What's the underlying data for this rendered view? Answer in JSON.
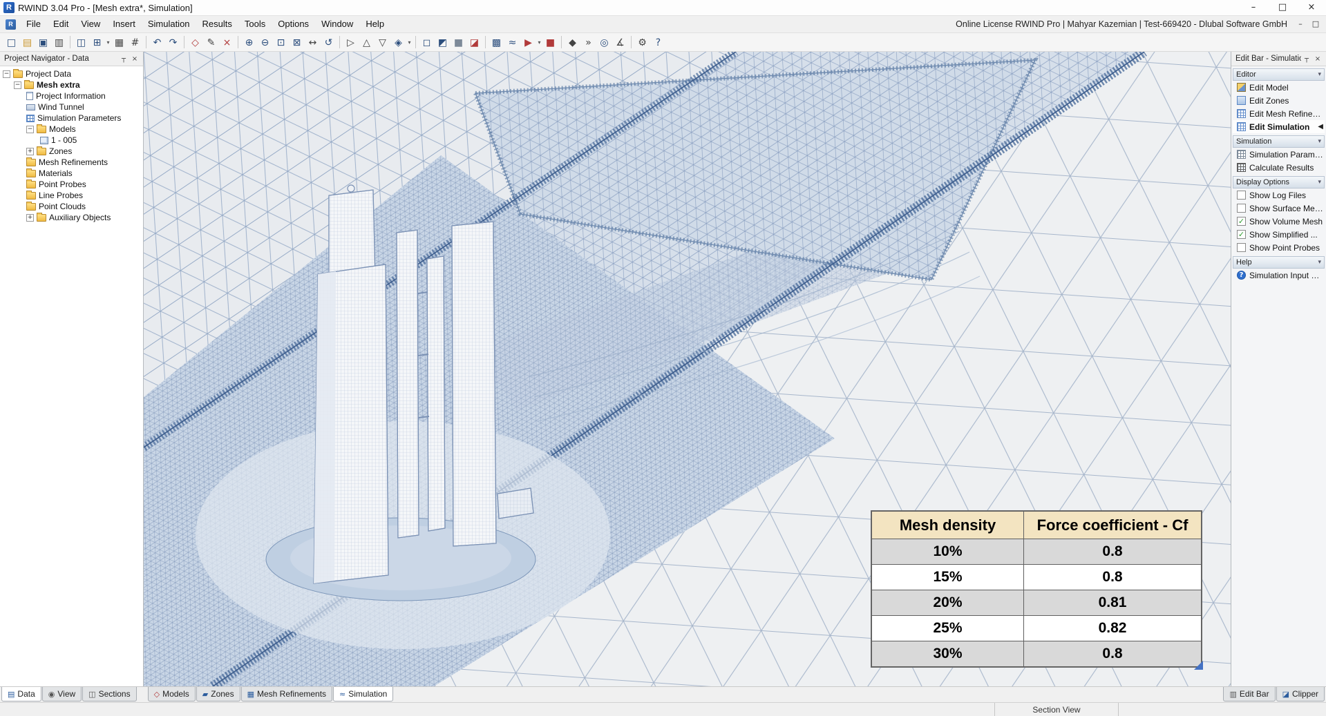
{
  "window": {
    "title": "RWIND 3.04 Pro - [Mesh extra*, Simulation]",
    "license_info": "Online License RWIND Pro | Mahyar Kazemian | Test-669420 - Dlubal Software GmbH",
    "app_initial": "R"
  },
  "menu": {
    "items": [
      "File",
      "Edit",
      "View",
      "Insert",
      "Simulation",
      "Results",
      "Tools",
      "Options",
      "Window",
      "Help"
    ]
  },
  "icons": {
    "minimize": "–",
    "maximize": "□",
    "close": "×",
    "pin": "┬",
    "chevron_down": "▾",
    "expander_open": "−",
    "expander_closed": "+",
    "active_arrow": "◀",
    "check": "✓",
    "help_question": "?",
    "tab_data": "▤",
    "tab_view": "◉",
    "tab_sections": "◫",
    "tab_models": "◇",
    "tab_zones": "▰",
    "tab_mesh": "▦",
    "tab_simulation": "≈",
    "tab_editbar": "▥",
    "tab_clipper": "◪"
  },
  "toolbar": {
    "icons": [
      {
        "name": "new-project",
        "glyph": "□"
      },
      {
        "name": "open-project",
        "glyph": "▤"
      },
      {
        "name": "save-project",
        "glyph": "▣"
      },
      {
        "name": "print",
        "glyph": "▥"
      },
      {
        "name": "project-navigator",
        "glyph": "◫"
      },
      {
        "name": "tables",
        "glyph": "⊞"
      },
      {
        "name": "snap-grid",
        "glyph": "▦"
      },
      {
        "name": "guidelines",
        "glyph": "#"
      },
      {
        "name": "undo",
        "glyph": "↶"
      },
      {
        "name": "redo",
        "glyph": "↷"
      },
      {
        "name": "new-model",
        "glyph": "◇"
      },
      {
        "name": "edit-model",
        "glyph": "✎"
      },
      {
        "name": "delete-model",
        "glyph": "×"
      },
      {
        "name": "zoom-in",
        "glyph": "⊕"
      },
      {
        "name": "zoom-out",
        "glyph": "⊖"
      },
      {
        "name": "zoom-window",
        "glyph": "⊡"
      },
      {
        "name": "zoom-all",
        "glyph": "⊠"
      },
      {
        "name": "pan-view",
        "glyph": "↔"
      },
      {
        "name": "rotate-view",
        "glyph": "↺"
      },
      {
        "name": "view-x",
        "glyph": "▷"
      },
      {
        "name": "view-y",
        "glyph": "△"
      },
      {
        "name": "view-z",
        "glyph": "▽"
      },
      {
        "name": "view-isometric",
        "glyph": "◈"
      },
      {
        "name": "wireframe-mode",
        "glyph": "◻"
      },
      {
        "name": "surface-mode",
        "glyph": "◩"
      },
      {
        "name": "solid-mode",
        "glyph": "■"
      },
      {
        "name": "section-plane",
        "glyph": "◪"
      },
      {
        "name": "show-mesh",
        "glyph": "▩"
      },
      {
        "name": "wind-profile",
        "glyph": "≈"
      },
      {
        "name": "run-simulation",
        "glyph": "▶"
      },
      {
        "name": "stop-simulation",
        "glyph": "■"
      },
      {
        "name": "results-overlay",
        "glyph": "◆"
      },
      {
        "name": "animate-flow",
        "glyph": "»"
      },
      {
        "name": "point-probe",
        "glyph": "◎"
      },
      {
        "name": "measure",
        "glyph": "∡"
      },
      {
        "name": "settings",
        "glyph": "⚙"
      },
      {
        "name": "help",
        "glyph": "?"
      }
    ]
  },
  "navigator": {
    "title": "Project Navigator - Data",
    "tree": [
      {
        "label": "Project Data"
      },
      {
        "label": "Mesh extra"
      },
      {
        "label": "Project Information"
      },
      {
        "label": "Wind Tunnel"
      },
      {
        "label": "Simulation Parameters"
      },
      {
        "label": "Models"
      },
      {
        "label": "1 - 005"
      },
      {
        "label": "Zones"
      },
      {
        "label": "Mesh Refinements"
      },
      {
        "label": "Materials"
      },
      {
        "label": "Point Probes"
      },
      {
        "label": "Line Probes"
      },
      {
        "label": "Point Clouds"
      },
      {
        "label": "Auxiliary Objects"
      }
    ]
  },
  "editbar": {
    "title": "Edit Bar - Simulation",
    "editor": {
      "label": "Editor",
      "items": [
        "Edit Model",
        "Edit Zones",
        "Edit Mesh Refinements",
        "Edit Simulation"
      ]
    },
    "simulation": {
      "label": "Simulation",
      "items": [
        "Simulation Parameter...",
        "Calculate Results"
      ]
    },
    "display": {
      "label": "Display Options",
      "options": [
        {
          "label": "Show Log Files",
          "checked": false
        },
        {
          "label": "Show Surface Mesh",
          "checked": false
        },
        {
          "label": "Show Volume Mesh",
          "checked": true
        },
        {
          "label": "Show Simplified ...",
          "checked": true
        },
        {
          "label": "Show Point Probes",
          "checked": false
        }
      ]
    },
    "help": {
      "label": "Help",
      "item": "Simulation Input Data"
    }
  },
  "chart_data": {
    "type": "table",
    "columns": [
      "Mesh density",
      "Force coefficient - Cf"
    ],
    "rows": [
      [
        "10%",
        "0.8"
      ],
      [
        "15%",
        "0.8"
      ],
      [
        "20%",
        "0.81"
      ],
      [
        "25%",
        "0.82"
      ],
      [
        "30%",
        "0.8"
      ]
    ]
  },
  "tabs": {
    "left": [
      "Data",
      "View",
      "Sections"
    ],
    "middle": [
      "Models",
      "Zones",
      "Mesh Refinements",
      "Simulation"
    ],
    "right": [
      "Edit Bar",
      "Clipper"
    ]
  },
  "statusbar": {
    "view_label": "Section View"
  },
  "colors": {
    "accent_blue": "#2c5d9e",
    "mesh_line": "#8ba3c4",
    "table_header_bg": "#f3e4c1",
    "table_alt_row_bg": "#d9d9d9",
    "check_green": "#2f9e2f",
    "hatch_blue": "#4e6f9d"
  }
}
